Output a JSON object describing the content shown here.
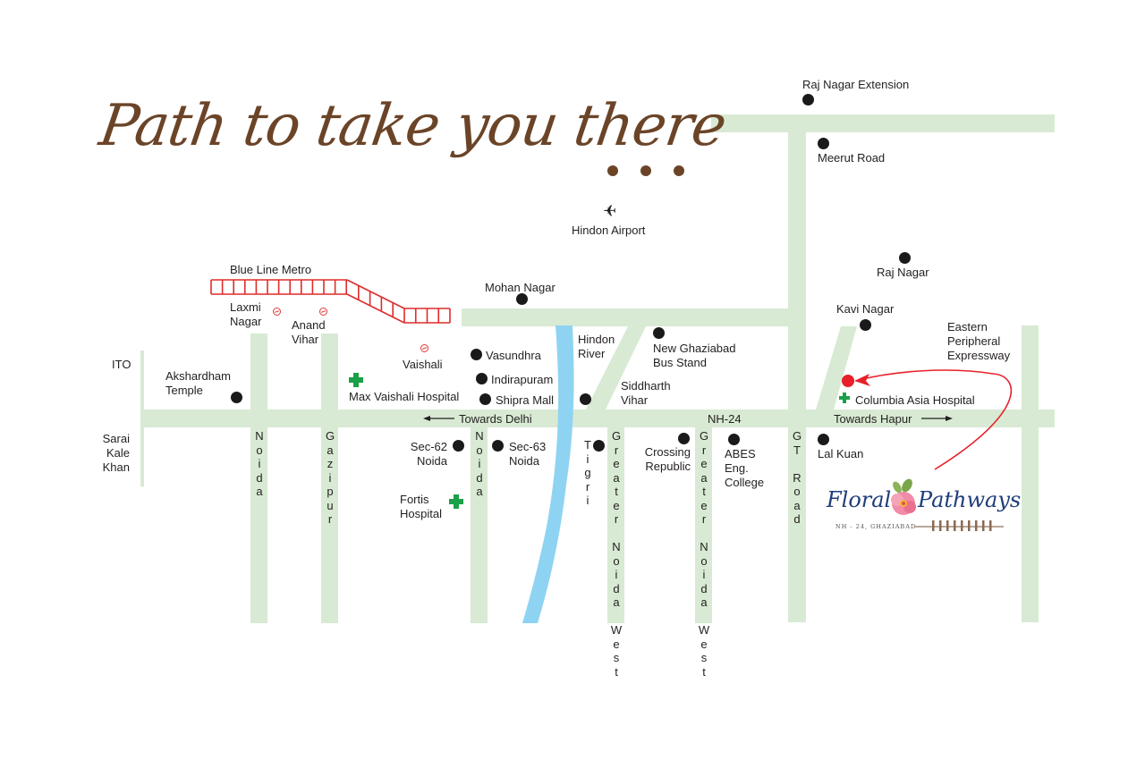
{
  "title": "Path to take you there",
  "title_ellipsis_dots": 3,
  "colors": {
    "road": "#d8ead3",
    "river": "#8fd3f2",
    "metro": "#e02b2b",
    "title": "#6b4428",
    "marker": "#1a1a1a",
    "destination_marker": "#e8202a",
    "hospital_cross": "#1aa048",
    "route_arrow": "#e8202a",
    "logo_text": "#1f3d7a"
  },
  "metro": {
    "label": "Blue Line Metro",
    "stations": [
      {
        "name": "Laxmi\nNagar",
        "icon": "metro-station-icon"
      },
      {
        "name": "Anand\nVihar",
        "icon": "metro-station-icon"
      },
      {
        "name": "Vaishali",
        "icon": "metro-station-icon"
      }
    ]
  },
  "airport": {
    "label": "Hindon Airport",
    "icon": "airplane-icon",
    "glyph": "✈"
  },
  "river": {
    "label": "Hindon\nRiver"
  },
  "roads": {
    "nh24": "NH-24",
    "towards_delhi": "Towards Delhi",
    "towards_hapur": "Towards Hapur",
    "noida_1": "Noida",
    "gazipur": "Gazipur",
    "noida_2": "Noida",
    "greater_noida_west_1": "Greater Noida West",
    "greater_noida_west_2": "Greater Noida West",
    "gt_road": "GT Road",
    "tigri": "Tigri",
    "eastern_peripheral": "Eastern\nPeripheral\nExpressway",
    "ito": "ITO",
    "sarai_kale_khan": "Sarai\nKale\nKhan"
  },
  "landmarks": {
    "akshardham": "Akshardham\nTemple",
    "mohan_nagar": "Mohan Nagar",
    "vasundhra": "Vasundhra",
    "indirapuram": "Indirapuram",
    "shipra_mall": "Shipra Mall",
    "siddharth_vihar": "Siddharth\nVihar",
    "new_ghaziabad_bus_stand": "New Ghaziabad\nBus Stand",
    "sec62": "Sec-62\nNoida",
    "sec63": "Sec-63\nNoida",
    "crossing_republic": "Crossing\nRepublic",
    "abes": "ABES\nEng.\nCollege",
    "lal_kuan": "Lal Kuan",
    "raj_nagar_extension": "Raj Nagar Extension",
    "meerut_road": "Meerut Road",
    "raj_nagar": "Raj Nagar",
    "kavi_nagar": "Kavi Nagar"
  },
  "hospitals": {
    "max_vaishali": "Max Vaishali Hospital",
    "fortis": "Fortis\nHospital",
    "columbia_asia": "Columbia Asia Hospital"
  },
  "logo": {
    "name_part1": "Floral",
    "name_part2": "Pathways",
    "subtitle": "NH - 24, GHAZIABAD"
  }
}
